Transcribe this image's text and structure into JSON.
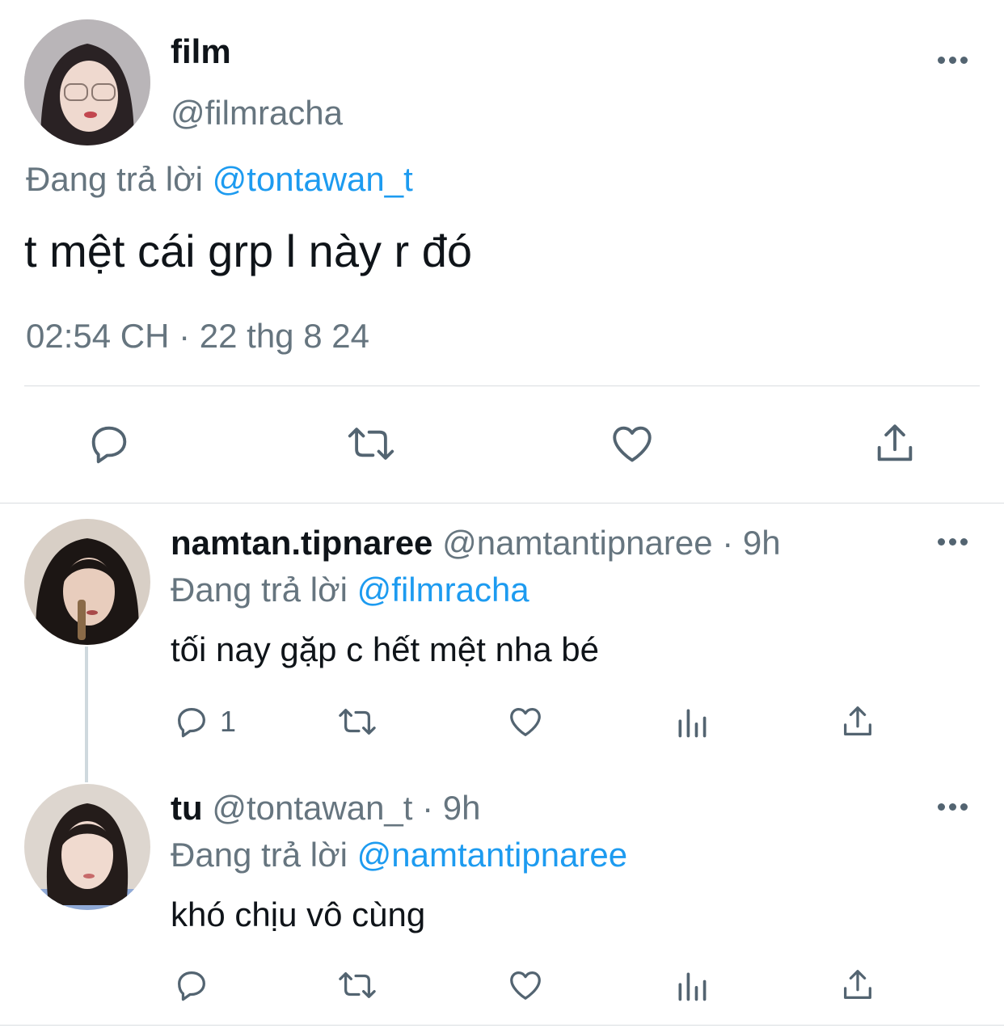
{
  "main_tweet": {
    "display_name": "film",
    "handle": "@filmracha",
    "reply_prefix": "Đang trả lời",
    "reply_to": "@tontawan_t",
    "text": "t mệt cái grp l này r đó",
    "timestamp": "02:54 CH · 22 thg 8 24"
  },
  "replies": [
    {
      "display_name": "namtan.tipnaree",
      "handle": "@namtantipnaree",
      "time": "· 9h",
      "reply_prefix": "Đang trả lời",
      "reply_to": "@filmracha",
      "text": "tối nay gặp c hết mệt nha bé",
      "reply_count": "1"
    },
    {
      "display_name": "tu",
      "handle": "@tontawan_t",
      "time": "· 9h",
      "reply_prefix": "Đang trả lời",
      "reply_to": "@namtantipnaree",
      "text": "khó chịu vô cùng",
      "reply_count": ""
    }
  ],
  "icons": {
    "reply": "reply-icon",
    "retweet": "retweet-icon",
    "like": "heart-icon",
    "share": "share-icon",
    "views": "views-icon",
    "more": "more-icon"
  },
  "colors": {
    "link": "#1d9bf0",
    "muted": "#66757f",
    "text": "#0f1419"
  }
}
